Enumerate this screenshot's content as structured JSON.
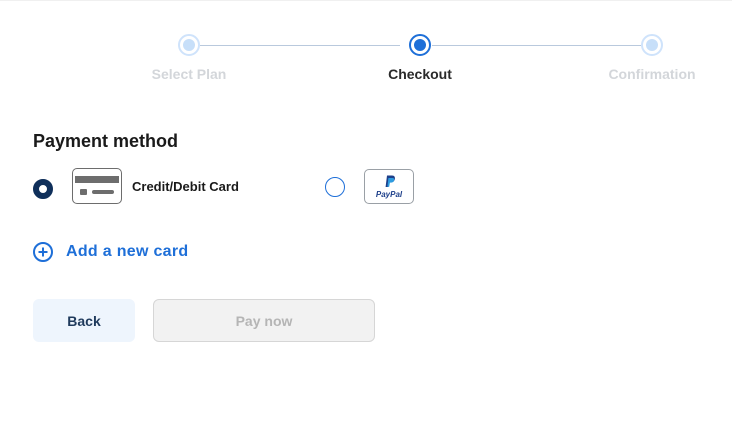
{
  "stepper": {
    "steps": [
      {
        "label": "Select Plan",
        "state": "inactive"
      },
      {
        "label": "Checkout",
        "state": "active"
      },
      {
        "label": "Confirmation",
        "state": "inactive"
      }
    ],
    "active_color": "#1e6fd8",
    "inactive_color": "#c7dff9"
  },
  "payment": {
    "title": "Payment method",
    "options": [
      {
        "label": "Credit/Debit Card",
        "icon": "credit-card-icon",
        "selected": true
      },
      {
        "label": "PayPal",
        "icon": "paypal-logo-icon",
        "selected": false
      }
    ]
  },
  "add_card": {
    "label": "Add a new card",
    "icon": "plus-circle-icon"
  },
  "buttons": {
    "back_label": "Back",
    "pay_label": "Pay now",
    "pay_disabled": true
  }
}
